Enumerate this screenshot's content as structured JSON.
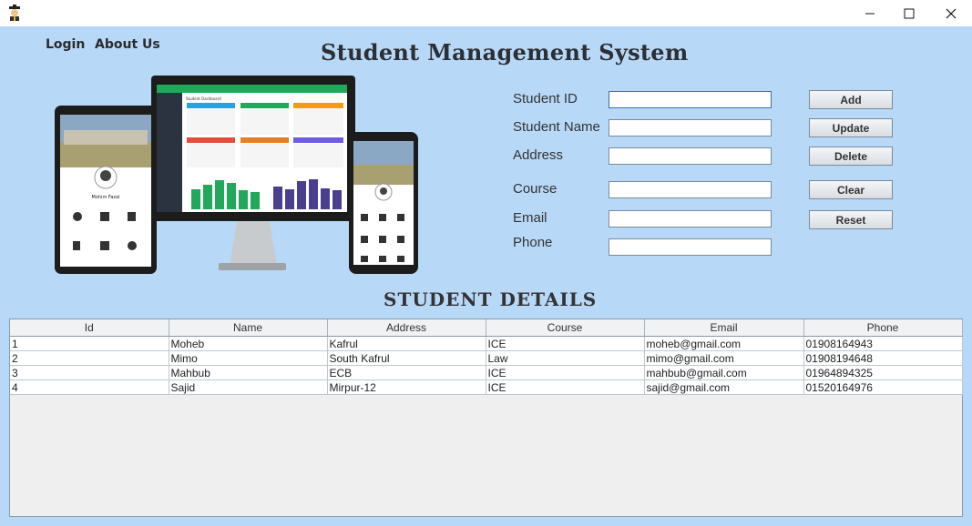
{
  "window": {
    "app_icon": "graduate-icon",
    "controls": {
      "minimize": "minimize-icon",
      "maximize": "maximize-icon",
      "close": "close-icon"
    }
  },
  "menu": {
    "login": "Login",
    "about": "About Us"
  },
  "header": {
    "title": "Student Management System"
  },
  "illustration": {
    "profile_name": "Mohim Fazal",
    "laptop_title": "Student Dashboard"
  },
  "form": {
    "fields": [
      {
        "label": "Student ID",
        "value": ""
      },
      {
        "label": "Student Name",
        "value": ""
      },
      {
        "label": "Address",
        "value": ""
      },
      {
        "label": "Course",
        "value": ""
      },
      {
        "label": "Email",
        "value": ""
      },
      {
        "label": "Phone",
        "value": ""
      }
    ]
  },
  "buttons": {
    "add": "Add",
    "update": "Update",
    "delete": "Delete",
    "clear": "Clear",
    "reset": "Reset"
  },
  "details": {
    "title": "STUDENT DETAILS",
    "columns": [
      "Id",
      "Name",
      "Address",
      "Course",
      "Email",
      "Phone"
    ],
    "rows": [
      [
        "1",
        "Moheb",
        "Kafrul",
        "ICE",
        "moheb@gmail.com",
        "01908164943"
      ],
      [
        "2",
        "Mimo",
        "South Kafrul",
        "Law",
        "mimo@gmail.com",
        "01908194648"
      ],
      [
        "3",
        "Mahbub",
        "ECB",
        "ICE",
        "mahbub@gmail.com",
        "01964894325"
      ],
      [
        "4",
        "Sajid",
        "Mirpur-12",
        "ICE",
        "sajid@gmail.com",
        "01520164976"
      ]
    ]
  },
  "colors": {
    "background": "#b8d8f8",
    "dashboard_green": "#22a85a",
    "dashboard_purple": "#4a3f8f"
  }
}
